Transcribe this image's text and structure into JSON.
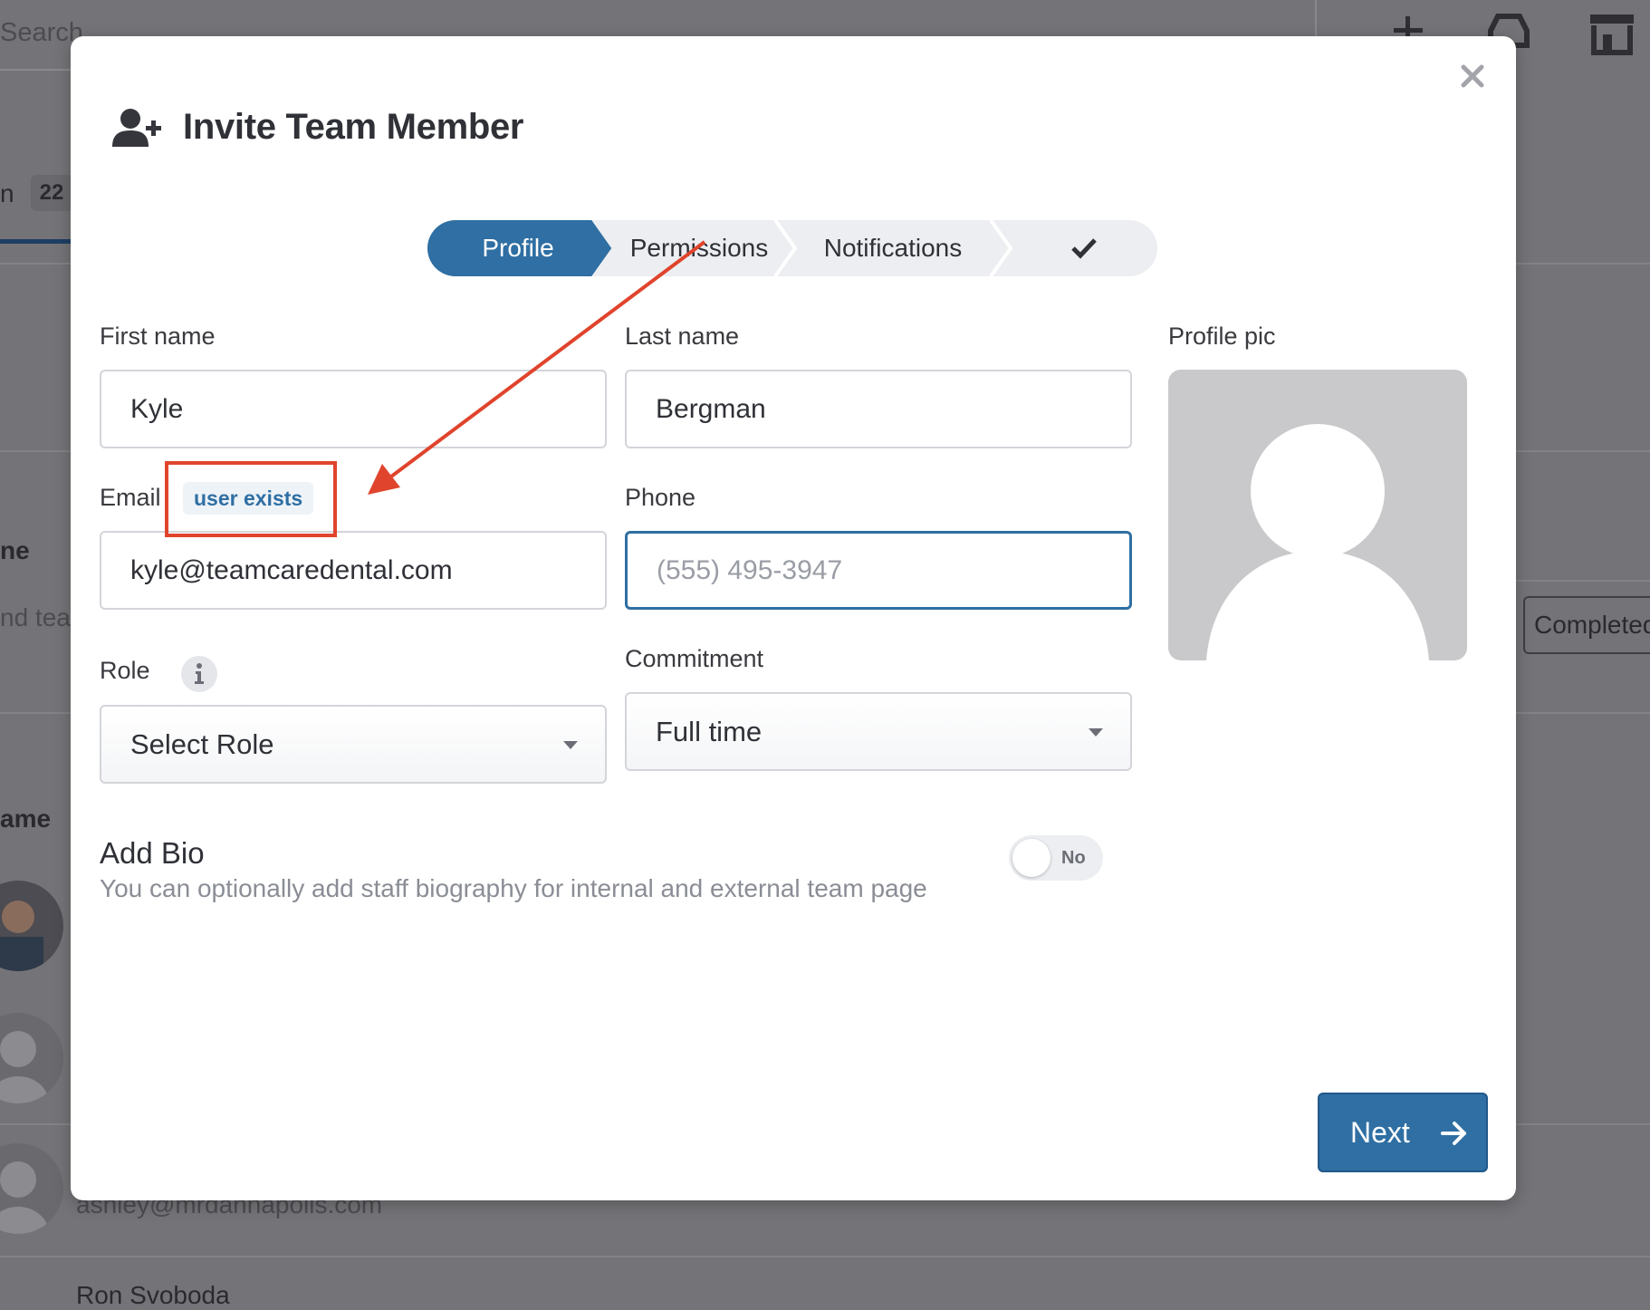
{
  "background": {
    "search_placeholder": "Search",
    "tab_suffix": "n",
    "tab_count": "22",
    "col_label_1": "ne",
    "filter_text": "nd tea",
    "status_completed": "Completed",
    "col_label_2": "ame",
    "email_row": "ashley@mrdannapolis.com",
    "name_row": "Ron Svoboda"
  },
  "modal": {
    "title": "Invite Team Member",
    "stepper": {
      "steps": [
        {
          "label": "Profile",
          "active": true
        },
        {
          "label": "Permissions",
          "active": false
        },
        {
          "label": "Notifications",
          "active": false
        }
      ],
      "final_icon": "check-icon"
    },
    "form": {
      "first_name": {
        "label": "First name",
        "value": "Kyle"
      },
      "last_name": {
        "label": "Last name",
        "value": "Bergman"
      },
      "email": {
        "label": "Email",
        "badge": "user exists",
        "value": "kyle@teamcaredental.com"
      },
      "phone": {
        "label": "Phone",
        "value": "",
        "placeholder": "(555) 495-3947"
      },
      "role": {
        "label": "Role",
        "selected": "Select Role"
      },
      "commitment": {
        "label": "Commitment",
        "selected": "Full time"
      },
      "profile_pic": {
        "label": "Profile pic"
      }
    },
    "bio": {
      "title": "Add Bio",
      "description": "You can optionally add staff biography for internal and external team page",
      "toggle_label": "No",
      "enabled": false
    },
    "next_label": "Next"
  },
  "colors": {
    "primary": "#2f6fa3",
    "annotation": "#e0442c",
    "overlay": "#747478"
  }
}
